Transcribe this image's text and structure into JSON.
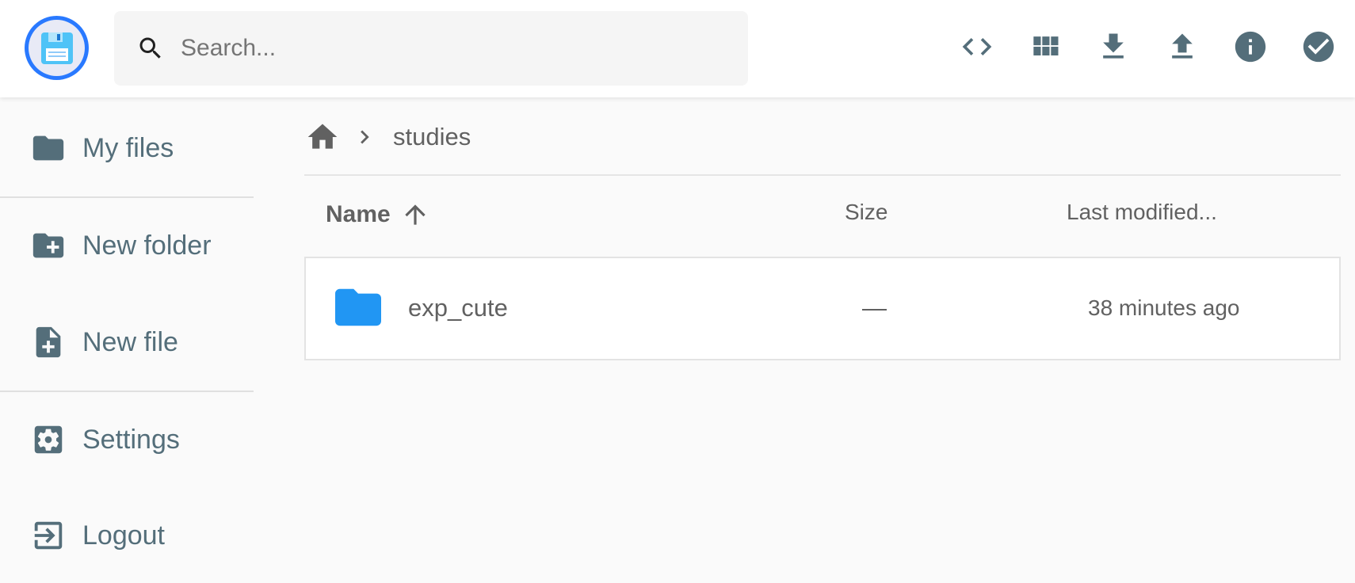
{
  "header": {
    "search": {
      "placeholder": "Search...",
      "value": ""
    },
    "toolbar": [
      {
        "icon": "code-icon",
        "title": "Toggle code view"
      },
      {
        "icon": "grid-view-icon",
        "title": "Switch view"
      },
      {
        "icon": "download-icon",
        "title": "Download"
      },
      {
        "icon": "upload-icon",
        "title": "Upload"
      },
      {
        "icon": "info-icon",
        "title": "Info"
      },
      {
        "icon": "check-circle-icon",
        "title": "Select multiple"
      }
    ]
  },
  "sidebar": {
    "items": [
      {
        "label": "My files",
        "icon": "folder-icon"
      },
      {
        "label": "New folder",
        "icon": "create-new-folder-icon"
      },
      {
        "label": "New file",
        "icon": "note-add-icon"
      },
      {
        "label": "Settings",
        "icon": "settings-icon"
      },
      {
        "label": "Logout",
        "icon": "exit-to-app-icon"
      }
    ]
  },
  "breadcrumb": {
    "home_icon": "home-icon",
    "separator_icon": "chevron-right-icon",
    "items": [
      "studies"
    ]
  },
  "listing": {
    "columns": {
      "name": "Name",
      "size": "Size",
      "modified": "Last modified..."
    },
    "sort_icon": "arrow-upward-icon",
    "rows": [
      {
        "name": "exp_cute",
        "size": "—",
        "modified": "38 minutes ago",
        "type": "folder",
        "icon": "folder-icon"
      }
    ]
  },
  "colors": {
    "accent": "#2979ff",
    "folder": "#2196f3",
    "icon": "#546e7a",
    "text": "#616161",
    "background": "#fafafa"
  }
}
